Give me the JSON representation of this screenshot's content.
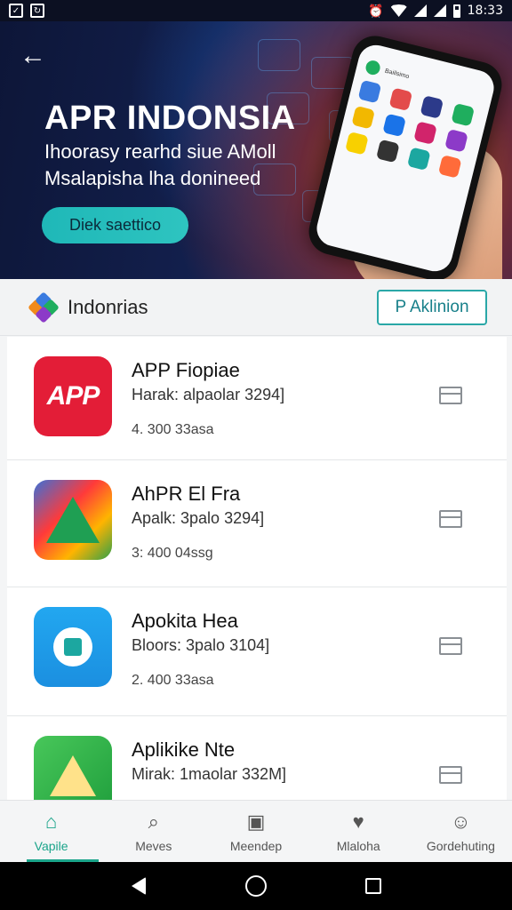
{
  "status_bar": {
    "time": "18:33",
    "icons": [
      "checkbox-icon",
      "sync-icon",
      "alarm-icon",
      "wifi-icon",
      "signal-icon",
      "signal-icon",
      "battery-icon"
    ]
  },
  "hero": {
    "title": "APR INDONSIA",
    "subtitle": "Ihoorasy rearhd siue AMoll Msalapisha lha donineed",
    "cta_label": "Diek saettico",
    "phone_header": "Baiilsimo"
  },
  "section": {
    "name": "Indonrias",
    "action_label": "P Aklinion"
  },
  "apps": [
    {
      "name": "APP Fiopiae",
      "meta": "Harak: alpaolar 3294]",
      "stats": "4. 300 33asa",
      "icon_label": "APP",
      "icon": "app-red-icon"
    },
    {
      "name": "AhPR El Fra",
      "meta": "Apalk: 3palo 3294]",
      "stats": "3: 400 04ssg",
      "icon": "triangle-multicolor-icon"
    },
    {
      "name": "Apokita Hea",
      "meta": "Bloors: 3palo 3104]",
      "stats": "2. 400 33asa",
      "icon": "blue-circle-icon"
    },
    {
      "name": "Aplikike Nte",
      "meta": "Mirak: 1maolar 332M]",
      "stats": "",
      "icon": "green-triangle-icon"
    }
  ],
  "bottom_nav": [
    {
      "label": "Vapile",
      "icon": "home-icon",
      "active": true
    },
    {
      "label": "Meves",
      "icon": "search-icon",
      "active": false
    },
    {
      "label": "Meendep",
      "icon": "apps-icon",
      "active": false
    },
    {
      "label": "Mlaloha",
      "icon": "heart-icon",
      "active": false
    },
    {
      "label": "Gordehuting",
      "icon": "person-icon",
      "active": false
    }
  ],
  "colors": {
    "accent": "#1aa48a",
    "cta": "#2ec4c0",
    "app_red": "#e31d37"
  }
}
